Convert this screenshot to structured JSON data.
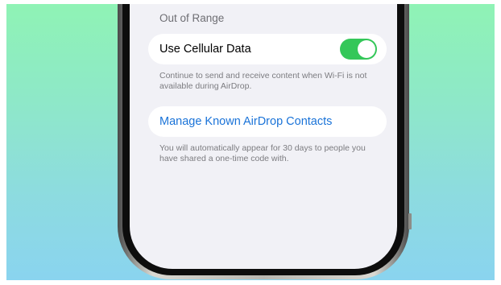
{
  "section_header": "Out of Range",
  "cellular": {
    "label": "Use Cellular Data",
    "toggle_state": "on",
    "footnote": "Continue to send and receive content when Wi-Fi is not available during AirDrop."
  },
  "contacts": {
    "label": "Manage Known AirDrop Contacts",
    "footnote": "You will automatically appear for 30 days to people you have shared a one-time code with."
  },
  "colors": {
    "toggle_on": "#34c759",
    "link": "#1a73d8",
    "screen_bg": "#f1f1f6",
    "gradient_top": "#8ff3b5",
    "gradient_bottom": "#8ad4ef"
  }
}
